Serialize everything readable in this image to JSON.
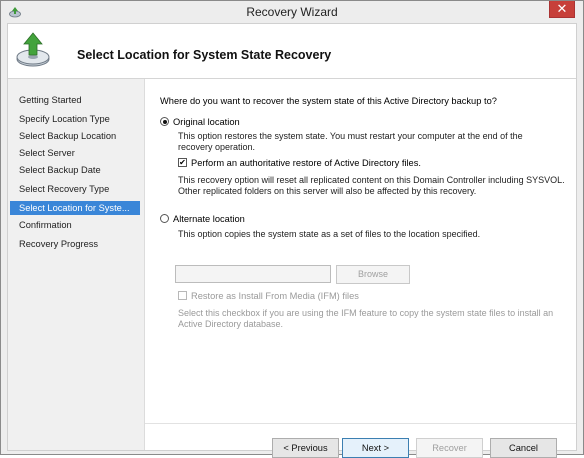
{
  "window": {
    "title": "Recovery Wizard",
    "close_glyph": "✕"
  },
  "header": {
    "title": "Select Location for System State Recovery",
    "icon": "backup-restore-icon"
  },
  "nav": {
    "items": [
      "Getting Started",
      "Specify Location Type",
      "Select Backup Location",
      "Select Server",
      "Select Backup Date",
      "Select Recovery Type",
      "Select Location for Syste...",
      "Confirmation",
      "Recovery Progress"
    ],
    "active_index": 6
  },
  "main": {
    "question": "Where do you want to recover the system state of this Active Directory backup to?",
    "original": {
      "label": "Original location",
      "selected": true,
      "desc": "This option restores the system state. You must restart your computer at the end of the recovery operation.",
      "auth_restore_label": "Perform an authoritative restore of Active Directory files.",
      "auth_restore_checked": true,
      "auth_restore_desc": "This recovery option will reset all replicated content on this Domain Controller including SYSVOL. Other replicated folders on this server will also be affected by this recovery."
    },
    "alternate": {
      "label": "Alternate location",
      "selected": false,
      "desc": "This option copies the system state as a set of files to the location specified.",
      "path_value": "",
      "browse_label": "Browse",
      "ifm_label": "Restore as Install From Media (IFM) files",
      "ifm_checked": false,
      "ifm_desc": "Select this checkbox if you are using the IFM feature to copy the system state files to install an Active Directory database."
    }
  },
  "buttons": {
    "previous": "< Previous",
    "next": "Next >",
    "recover": "Recover",
    "cancel": "Cancel"
  },
  "colors": {
    "nav_selected": "#3a86d8",
    "close_button": "#c7403a"
  }
}
